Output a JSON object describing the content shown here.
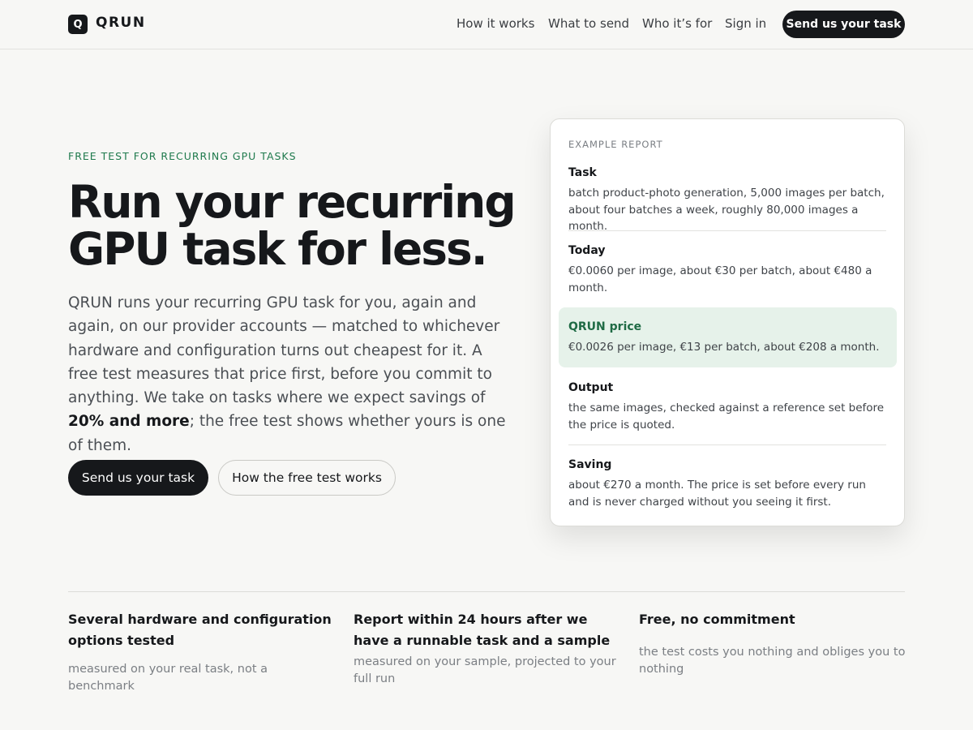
{
  "brand": {
    "logo_letter": "Q",
    "name": "QRUN"
  },
  "nav": {
    "items": [
      "How it works",
      "What to send",
      "Who it’s for",
      "Sign in"
    ],
    "cta": "Send us your task"
  },
  "hero": {
    "eyebrow": "FREE TEST FOR RECURRING GPU TASKS",
    "headline_line1": "Run your recurring",
    "headline_line2": "GPU task for less.",
    "lead_before": "QRUN runs your recurring GPU task for you, again and again, on our provider accounts — matched to whichever hardware and configuration turns out cheapest for it. A free test measures that price first, before you commit to anything. We take on tasks where we expect savings of ",
    "lead_bold": "20% and more",
    "lead_after": "; the free test shows whether yours is one of them.",
    "primary_button": "Send us your task",
    "secondary_button": "How the free test works"
  },
  "report": {
    "label": "EXAMPLE REPORT",
    "sections": [
      {
        "title": "Task",
        "body": "batch product-photo generation, 5,000 images per batch, about four batches a week, roughly 80,000 images a month."
      },
      {
        "title": "Today",
        "body": "€0.0060 per image, about €30 per batch, about €480 a month."
      },
      {
        "title": "QRUN price",
        "body": "€0.0026 per image, €13 per batch, about €208 a month."
      },
      {
        "title": "Output",
        "body": "the same images, checked against a reference set before the price is quoted."
      },
      {
        "title": "Saving",
        "body": "about €270 a month. The price is set before every run and is never charged without you seeing it first."
      }
    ]
  },
  "features": [
    {
      "title": "Several hardware and configuration options tested",
      "desc": "measured on your real task, not a benchmark"
    },
    {
      "title": "Report within 24 hours after we have a runnable task and a sample",
      "desc": "measured on your sample, projected to your full run"
    },
    {
      "title": "Free, no commitment",
      "desc": "the test costs you nothing and obliges you to nothing"
    }
  ],
  "colors": {
    "ink": "#16181b",
    "accent_green": "#1f7a4d",
    "highlight_bg": "#e6f2ea",
    "background": "#f7f7f5"
  }
}
